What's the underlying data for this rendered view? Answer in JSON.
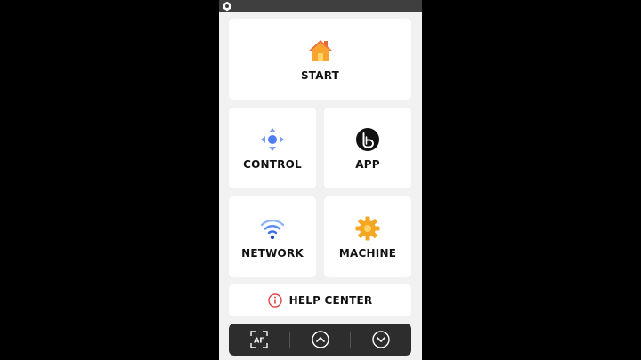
{
  "status_bar": {
    "icon": "settings-hex-icon"
  },
  "tiles": {
    "start": {
      "label": "START",
      "icon": "home-icon"
    },
    "control": {
      "label": "CONTROL",
      "icon": "directional-pad-icon"
    },
    "app": {
      "label": "APP",
      "icon": "app-logo-icon"
    },
    "network": {
      "label": "NETWORK",
      "icon": "wifi-icon"
    },
    "machine": {
      "label": "MACHINE",
      "icon": "gear-icon"
    },
    "help": {
      "label": "HELP CENTER",
      "icon": "info-icon"
    }
  },
  "bottom_bar": {
    "af_label": "AF",
    "buttons": [
      "autofocus-icon",
      "chevron-up-circle-icon",
      "chevron-down-circle-icon"
    ]
  },
  "colors": {
    "background": "#000000",
    "screen": "#f1f1f1",
    "tile": "#ffffff",
    "accent_blue": "#4d7cf5",
    "accent_orange": "#f5a623",
    "help_red": "#e04545",
    "bottom_bar": "#2d2d2d"
  }
}
